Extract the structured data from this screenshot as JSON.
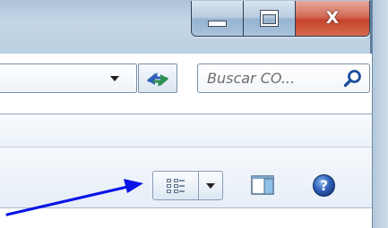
{
  "window": {
    "controls": {
      "minimize_icon": "minimize-icon",
      "maximize_icon": "maximize-icon",
      "close_label": "X"
    },
    "close_color": "#c9452f"
  },
  "address_bar": {
    "dropdown_icon": "chevron-down-icon",
    "refresh_icon": "refresh-icon"
  },
  "search": {
    "placeholder": "Buscar CO...",
    "icon": "search-icon"
  },
  "toolbar": {
    "views_icon": "details-view-icon",
    "views_dropdown_icon": "chevron-down-icon",
    "preview_icon": "preview-pane-icon",
    "help_icon": "help-icon"
  },
  "annotation": {
    "arrow_color": "#0a14e6",
    "target": "views-button"
  }
}
